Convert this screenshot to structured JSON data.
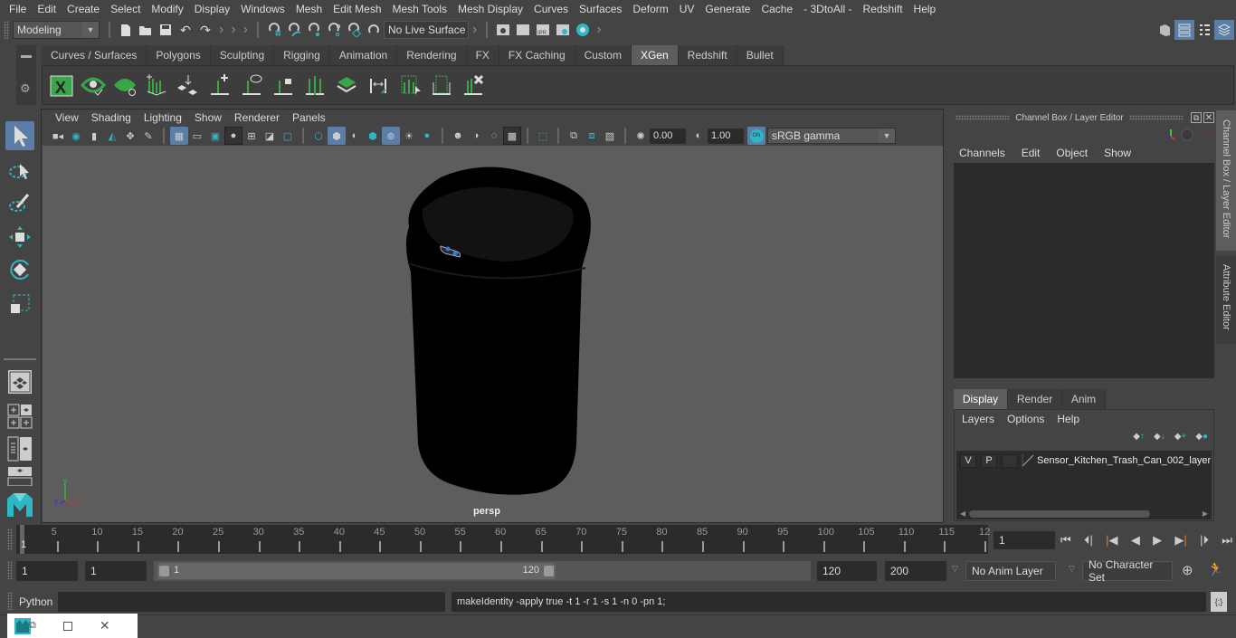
{
  "menubar": {
    "items": [
      "File",
      "Edit",
      "Create",
      "Select",
      "Modify",
      "Display",
      "Windows",
      "Mesh",
      "Edit Mesh",
      "Mesh Tools",
      "Mesh Display",
      "Curves",
      "Surfaces",
      "Deform",
      "UV",
      "Generate",
      "Cache",
      "- 3DtoAll -",
      "Redshift",
      "Help"
    ]
  },
  "statusline": {
    "mode_selector": "Modeling",
    "live_surface": "No Live Surface",
    "icons": [
      "new-scene-icon",
      "open-scene-icon",
      "save-scene-icon",
      "undo-icon",
      "redo-icon",
      "snap-grid-icon",
      "snap-curve-icon",
      "snap-point-icon",
      "snap-view-plane-icon",
      "snap-live-icon",
      "make-live-icon",
      "render-view-icon",
      "render-frame-icon",
      "ipr-render-icon",
      "render-settings-icon",
      "hypershade-icon"
    ],
    "right_icons": [
      "modeling-toolkit-icon",
      "attribute-editor-toggle-icon",
      "outliner-toggle-icon",
      "channel-box-toggle-icon"
    ]
  },
  "shelf": {
    "tabs": [
      "Curves / Surfaces",
      "Polygons",
      "Sculpting",
      "Rigging",
      "Animation",
      "Rendering",
      "FX",
      "FX Caching",
      "Custom",
      "XGen",
      "Redshift",
      "Bullet"
    ],
    "active_tab": "XGen",
    "icons": [
      "xgen-editor-icon",
      "xgen-preview-icon",
      "xgen-clear-preview-icon",
      "xgen-create-interactive-groom-icon",
      "xgen-convert-icon",
      "xgen-add-spline-icon",
      "xgen-visibility-icon",
      "xgen-lock-icon",
      "xgen-split-icon",
      "xgen-density-icon",
      "xgen-transfer-icon",
      "xgen-select-icon",
      "xgen-region-icon",
      "xgen-delete-icon"
    ]
  },
  "viewport": {
    "menu": [
      "View",
      "Shading",
      "Lighting",
      "Show",
      "Renderer",
      "Panels"
    ],
    "exposure": "0.00",
    "gamma": "1.00",
    "color_management": "ON",
    "color_space": "sRGB gamma",
    "camera_label": "persp",
    "axis": {
      "x": "x",
      "y": "y",
      "z": "z"
    }
  },
  "toolbox": {
    "tools": [
      "select-tool",
      "lasso-tool",
      "paint-select-tool",
      "move-tool",
      "rotate-tool",
      "scale-tool"
    ],
    "layouts": [
      "single-pane-layout",
      "four-pane-layout",
      "outliner-persp-layout",
      "persp-graph-layout"
    ]
  },
  "channel_box": {
    "title": "Channel Box / Layer Editor",
    "menu": [
      "Channels",
      "Edit",
      "Object",
      "Show"
    ],
    "layer_tabs": [
      "Display",
      "Render",
      "Anim"
    ],
    "active_layer_tab": "Display",
    "layer_menu": [
      "Layers",
      "Options",
      "Help"
    ],
    "layers": [
      {
        "visible": "V",
        "playback": "P",
        "type": "",
        "name": "Sensor_Kitchen_Trash_Can_002_layer"
      }
    ]
  },
  "side_tabs": [
    "Channel Box / Layer Editor",
    "Attribute Editor"
  ],
  "timeline": {
    "start_label": "1",
    "ticks": [
      "5",
      "10",
      "15",
      "20",
      "25",
      "30",
      "35",
      "40",
      "45",
      "50",
      "55",
      "60",
      "65",
      "70",
      "75",
      "80",
      "85",
      "90",
      "95",
      "100",
      "105",
      "110",
      "115",
      "12"
    ],
    "current_frame": "1"
  },
  "range": {
    "start_frame": "1",
    "playback_start": "1",
    "slider_start": "1",
    "slider_end": "120",
    "playback_end": "120",
    "end_frame": "200",
    "anim_layer": "No Anim Layer",
    "character_set": "No Character Set"
  },
  "command_line": {
    "language": "Python",
    "input": "",
    "result": "makeIdentity -apply true -t 1 -r 1 -s 1 -n 0 -pn 1;"
  },
  "colors": {
    "accent_blue": "#5a7ea6",
    "teal": "#2fb6c4",
    "xgen_green": "#3aa64a",
    "key_orange": "#e0803a"
  }
}
